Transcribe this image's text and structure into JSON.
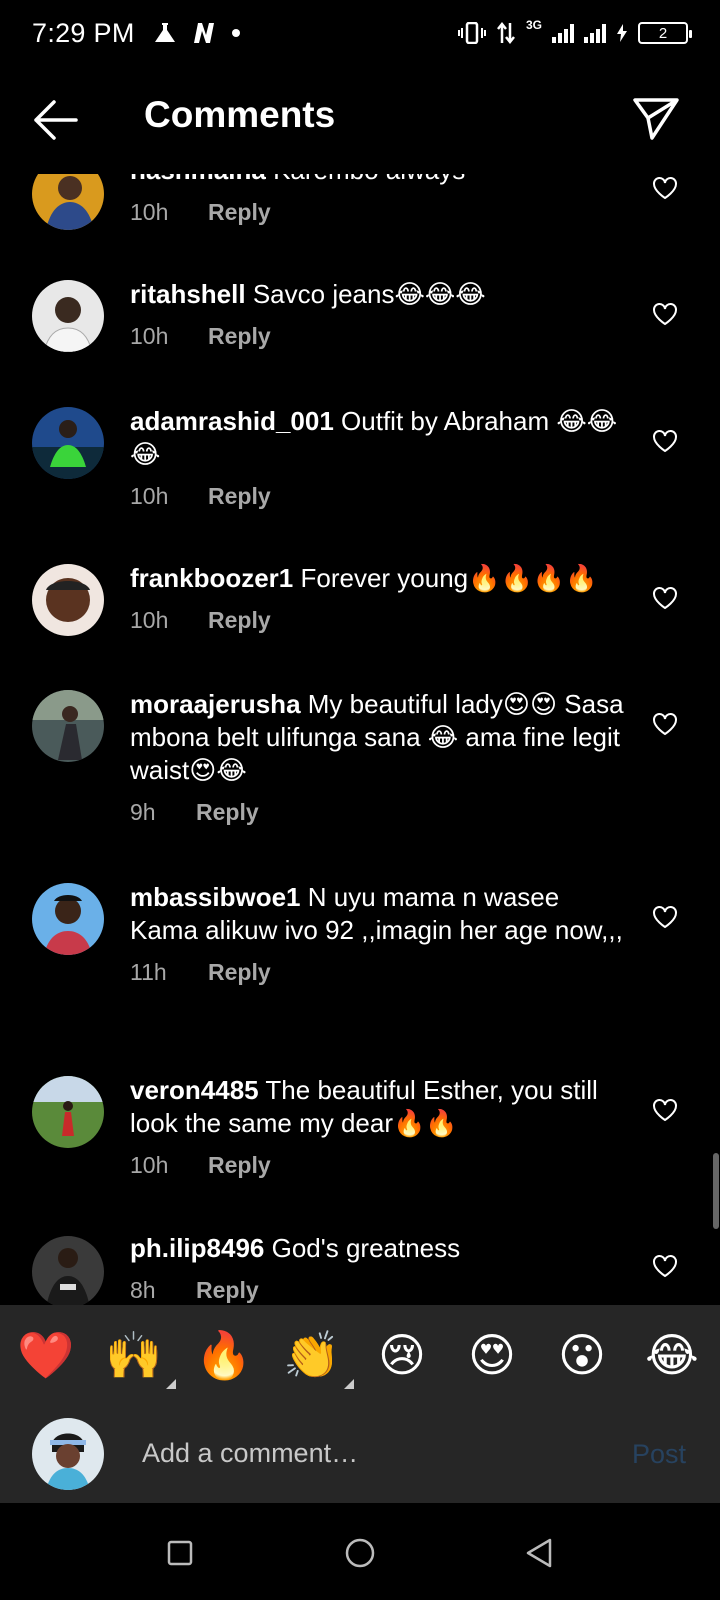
{
  "status_bar": {
    "time": "7:29 PM",
    "network": "3G",
    "battery": "2"
  },
  "header": {
    "title": "Comments",
    "back_icon": "arrow-left-icon",
    "send_icon": "paper-plane-icon"
  },
  "comments": [
    {
      "username": "nashmaina",
      "text": "Karembo always",
      "time": "10h",
      "reply": "Reply"
    },
    {
      "username": "ritahshell",
      "text": "Savco jeans😂😂😂",
      "time": "10h",
      "reply": "Reply"
    },
    {
      "username": "adamrashid_001",
      "text": "Outfit by Abraham 😂😂😂",
      "time": "10h",
      "reply": "Reply"
    },
    {
      "username": "frankboozer1",
      "text": "Forever young🔥🔥🔥🔥",
      "time": "10h",
      "reply": "Reply"
    },
    {
      "username": "moraajerusha",
      "text": "My beautiful lady😍😍 Sasa mbona belt ulifunga sana 😂 ama fine legit waist😍😂",
      "time": "9h",
      "reply": "Reply"
    },
    {
      "username": "mbassibwoe1",
      "text": "N uyu mama n wasee Kama alikuw ivo 92 ,,imagin her age now,,,",
      "time": "11h",
      "reply": "Reply"
    },
    {
      "username": "veron4485",
      "text": "The beautiful Esther, you still look the same my dear🔥🔥",
      "time": "10h",
      "reply": "Reply"
    },
    {
      "username": "ph.ilip8496",
      "text": "God's greatness",
      "time": "8h",
      "reply": "Reply"
    }
  ],
  "reactions": [
    "❤️",
    "🙌",
    "🔥",
    "👏",
    "😢",
    "😍",
    "😮",
    "😂"
  ],
  "composer": {
    "placeholder": "Add a comment…",
    "post_label": "Post"
  },
  "colors": {
    "background": "#000000",
    "panel": "#262626",
    "meta_text": "#a8a8a8",
    "post_disabled": "#27425f"
  }
}
